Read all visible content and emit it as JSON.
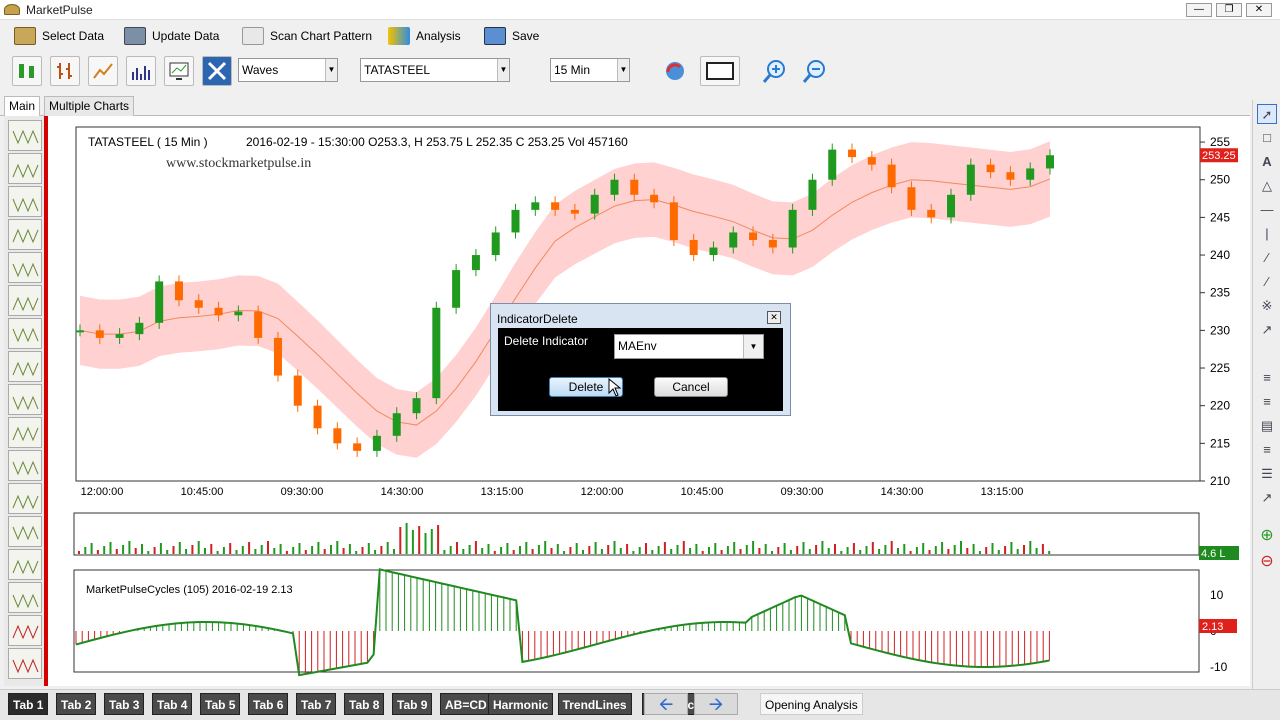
{
  "app": {
    "title": "MarketPulse"
  },
  "menu": {
    "items": [
      {
        "label": "Select Data",
        "icon": "database-icon"
      },
      {
        "label": "Update Data",
        "icon": "update-icon"
      },
      {
        "label": "Scan Chart Pattern",
        "icon": "scan-icon"
      },
      {
        "label": "Analysis",
        "icon": "analysis-icon"
      },
      {
        "label": "Save",
        "icon": "save-icon"
      }
    ]
  },
  "toolbar": {
    "indicator_select": "Waves",
    "symbol_select": "TATASTEEL",
    "timeframe_select": "15 Min"
  },
  "top_tabs": [
    "Main",
    "Multiple Charts"
  ],
  "chart": {
    "header": "TATASTEEL  ( 15 Min )",
    "ohlc": "2016-02-19 - 15:30:00  O253.3, H 253.75 L 252.35 C 253.25  Vol 457160",
    "watermark": "www.stockmarketpulse.in",
    "price_ticks": [
      "255",
      "250",
      "245",
      "240",
      "235",
      "230",
      "225",
      "220",
      "215",
      "210"
    ],
    "time_ticks": [
      "12:00:00",
      "10:45:00",
      "09:30:00",
      "14:30:00",
      "13:15:00",
      "12:00:00",
      "10:45:00",
      "09:30:00",
      "14:30:00",
      "13:15:00"
    ],
    "last_price_badge": "253.25",
    "volume_badge": "4.6 L",
    "osc_label": "MarketPulseCycles  (105)  2016-02-19  2.13",
    "osc_ticks": [
      "10",
      "0",
      "-10"
    ],
    "osc_badge": "2.13",
    "colors": {
      "up": "#1f9a1f",
      "down": "#ff6a00",
      "band": "#ffc9c9",
      "ma": "#f08a5d",
      "badge": "#e0201a"
    }
  },
  "chart_data": {
    "type": "line",
    "title": "TATASTEEL  ( 15 Min )",
    "xlabel": "",
    "ylabel": "",
    "x_ticks": [
      "12:00:00",
      "10:45:00",
      "09:30:00",
      "14:30:00",
      "13:15:00",
      "12:00:00",
      "10:45:00",
      "09:30:00",
      "14:30:00",
      "13:15:00"
    ],
    "ylim": [
      210,
      257
    ],
    "series": [
      {
        "values": [
          230,
          229,
          229.5,
          231,
          236.5,
          234,
          233,
          232,
          232.5,
          229,
          224,
          220,
          217,
          215,
          214,
          216,
          219,
          221,
          233,
          238,
          240,
          243,
          246,
          247,
          246,
          245.5,
          248,
          250,
          248,
          247,
          242,
          240,
          241,
          243,
          242,
          241,
          246,
          250,
          254,
          253,
          252,
          249,
          246,
          245,
          248,
          252,
          251,
          250,
          251.5,
          253.25
        ]
      }
    ]
  },
  "dialog": {
    "title": "IndicatorDelete",
    "field_label": "Delete Indicator",
    "select_value": "MAEnv",
    "delete_label": "Delete",
    "cancel_label": "Cancel"
  },
  "bottom_tabs": [
    "Tab 1",
    "Tab 2",
    "Tab 3",
    "Tab 4",
    "Tab 5",
    "Tab 6",
    "Tab 7",
    "Tab 8",
    "Tab 9",
    "AB=CD",
    "Harmonic",
    "TrendLines",
    "Price Action"
  ],
  "status": {
    "opening_analysis": "Opening Analysis"
  }
}
